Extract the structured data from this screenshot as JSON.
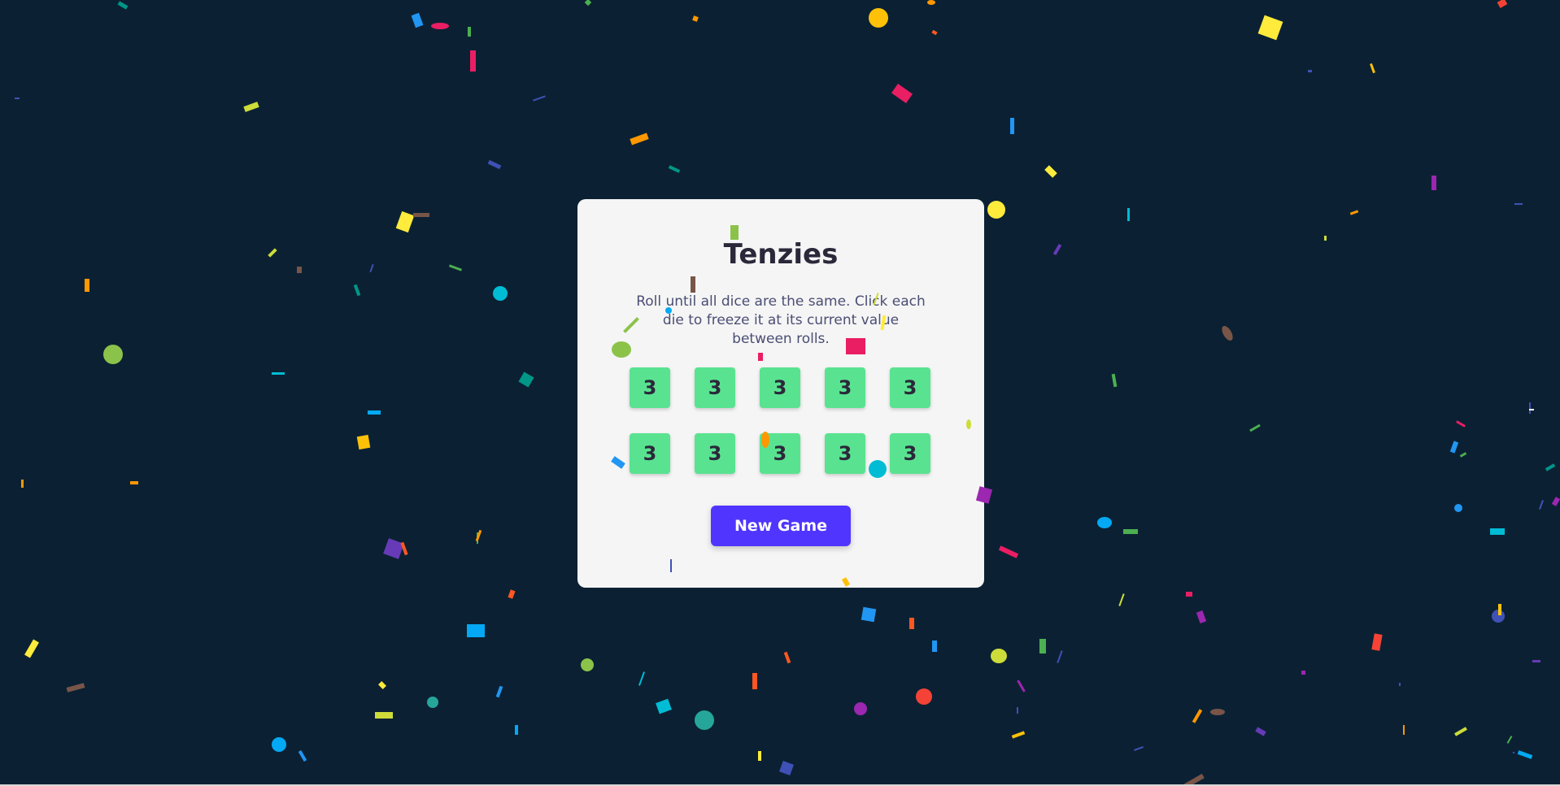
{
  "game": {
    "title": "Tenzies",
    "instructions": "Roll until all dice are the same. Click each die to freeze it at its current value between rolls.",
    "dice": [
      3,
      3,
      3,
      3,
      3,
      3,
      3,
      3,
      3,
      3
    ],
    "button_label": "New Game"
  },
  "colors": {
    "background": "#0b2133",
    "card": "#f5f5f5",
    "die_held": "#59e391",
    "button": "#5035ff",
    "title_text": "#2b283a"
  },
  "decorations": {
    "effect": "confetti"
  }
}
